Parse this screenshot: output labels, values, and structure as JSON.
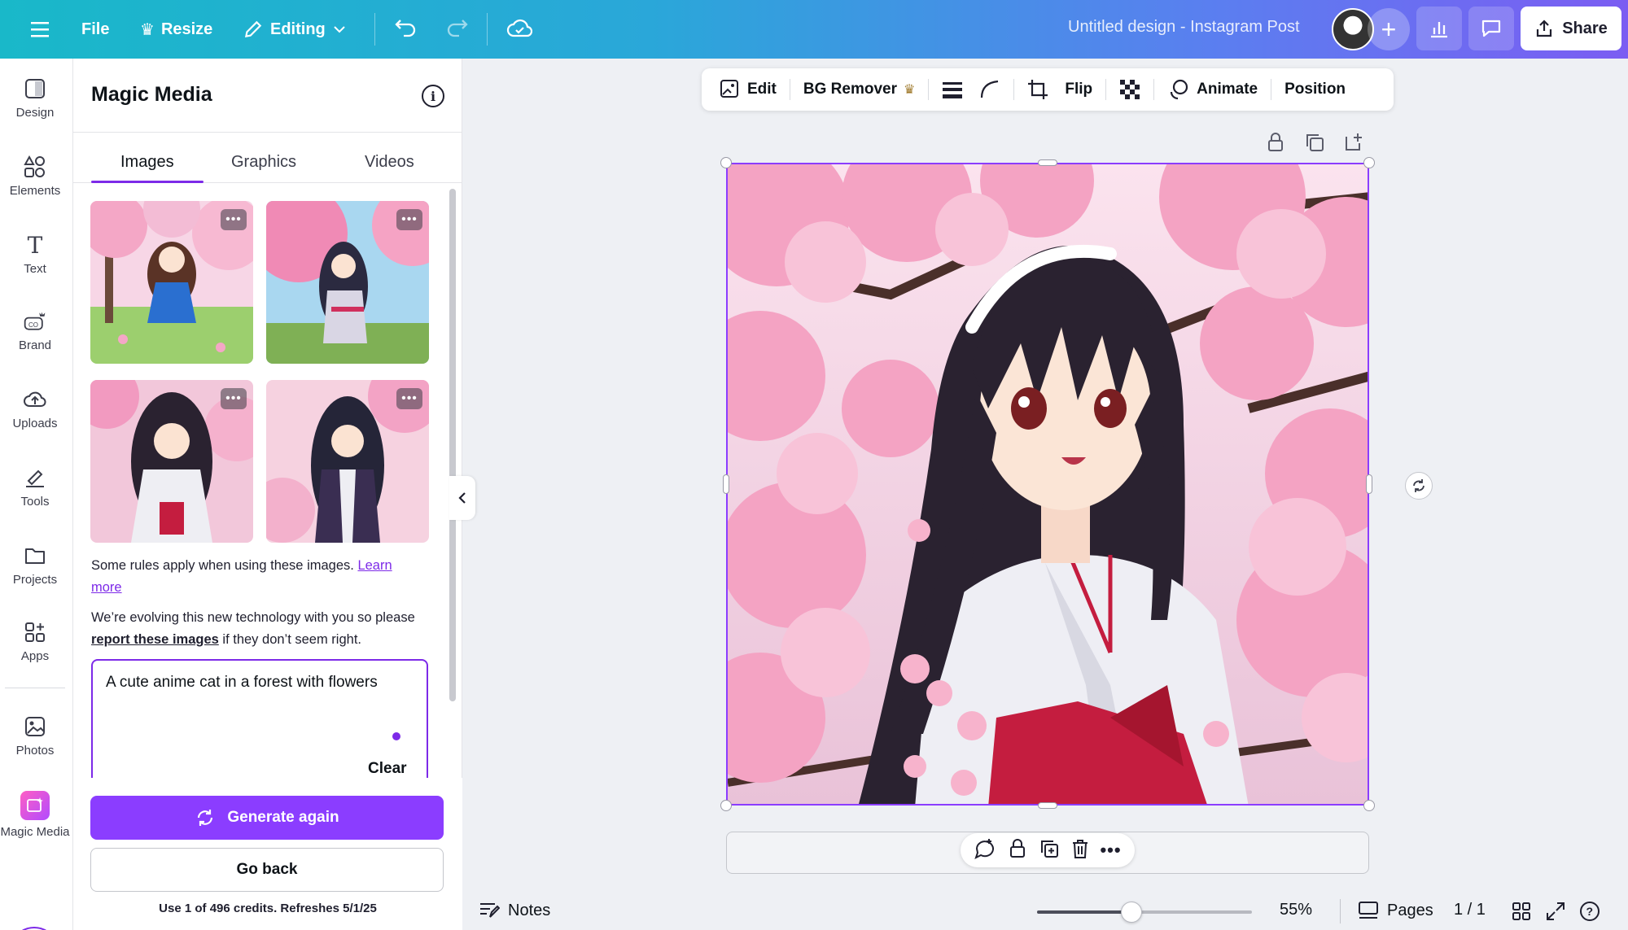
{
  "topbar": {
    "file": "File",
    "resize": "Resize",
    "editing": "Editing",
    "title": "Untitled design - Instagram Post",
    "share": "Share"
  },
  "rail": {
    "items": [
      {
        "label": "Design"
      },
      {
        "label": "Elements"
      },
      {
        "label": "Text"
      },
      {
        "label": "Brand"
      },
      {
        "label": "Uploads"
      },
      {
        "label": "Tools"
      },
      {
        "label": "Projects"
      },
      {
        "label": "Apps"
      },
      {
        "label": "Photos"
      },
      {
        "label": "Magic Media"
      }
    ]
  },
  "panel": {
    "title": "Magic Media",
    "tabs": [
      "Images",
      "Graphics",
      "Videos"
    ],
    "active_tab": "Images",
    "note1_prefix": "Some rules apply when using these images.",
    "note1_link": "Learn more",
    "note2_prefix": "We’re evolving this new technology with you so please",
    "note2_link": "report these images",
    "note2_suffix": "if they don’t seem right.",
    "prompt": "A cute anime cat in a forest with flowers",
    "clear": "Clear",
    "generate": "Generate again",
    "back": "Go back",
    "credits": "Use 1 of 496 credits. Refreshes 5/1/25"
  },
  "toolbar": {
    "edit": "Edit",
    "bg_remover": "BG Remover",
    "flip": "Flip",
    "animate": "Animate",
    "position": "Position"
  },
  "bottom": {
    "notes": "Notes",
    "zoom": "55%",
    "zoom_fraction": 0.44,
    "pages": "Pages",
    "page_count": "1 / 1"
  },
  "colors": {
    "accent": "#8b3dff",
    "blossom": "#f5a9c8",
    "hair": "#2a2230"
  }
}
